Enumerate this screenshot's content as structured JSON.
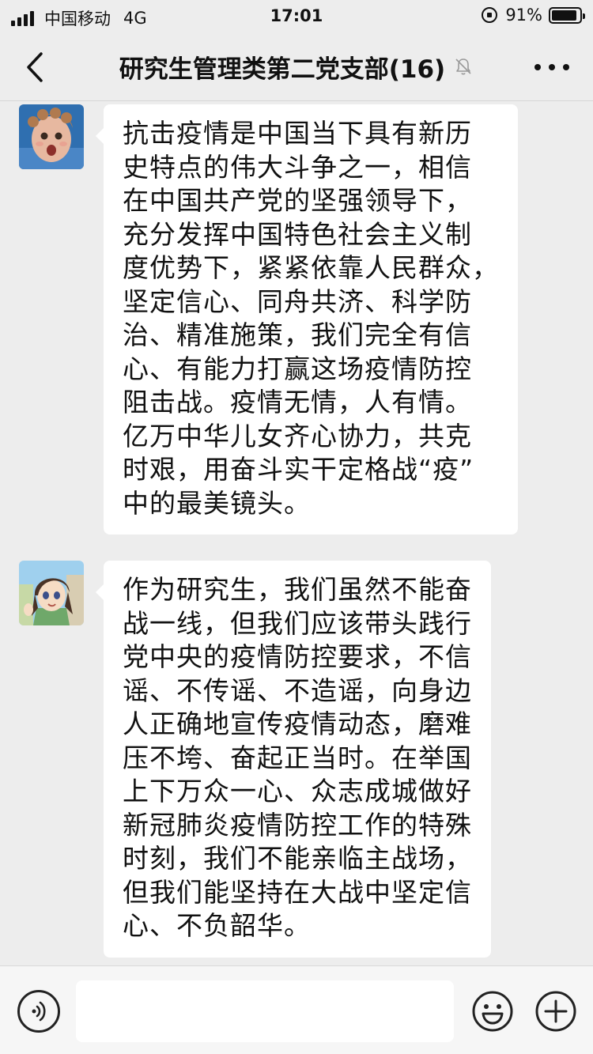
{
  "status_bar": {
    "carrier": "中国移动",
    "network": "4G",
    "time": "17:01",
    "battery_percent_label": "91%",
    "battery_level": 0.91
  },
  "nav": {
    "title": "研究生管理类第二党支部(16)",
    "icons": {
      "back": "chevron-left-icon",
      "mute": "bell-muted-icon",
      "more": "more-dots-icon"
    }
  },
  "messages": [
    {
      "sender_avatar": "baby-avatar",
      "lines": [
        "抗击疫情是中国当下具有新历",
        "史特点的伟大斗争之一，相信",
        "在中国共产党的坚强领导下，",
        "充分发挥中国特色社会主义制",
        "度优势下，紧紧依靠人民群众，",
        "坚定信心、同舟共济、科学防",
        "治、精准施策，我们完全有信",
        "心、有能力打赢这场疫情防控",
        "阻击战。疫情无情，人有情。",
        "亿万中华儿女齐心协力，共克",
        "时艰，用奋斗实干定格战“疫”",
        "中的最美镜头。"
      ]
    },
    {
      "sender_avatar": "anime-girl-avatar",
      "lines": [
        "作为研究生，我们虽然不能奋",
        "战一线，但我们应该带头践行",
        "党中央的疫情防控要求，不信",
        "谣、不传谣、不造谣，向身边",
        "人正确地宣传疫情动态，磨难",
        "压不垮、奋起正当时。在举国",
        "上下万众一心、众志成城做好",
        "新冠肺炎疫情防控工作的特殊",
        "时刻，我们不能亲临主战场，",
        "但我们能坚持在大战中坚定信",
        "心、不负韶华。"
      ]
    }
  ],
  "input_bar": {
    "text_value": "",
    "icons": {
      "voice": "voice-icon",
      "emoji": "emoji-icon",
      "plus": "plus-icon"
    }
  }
}
